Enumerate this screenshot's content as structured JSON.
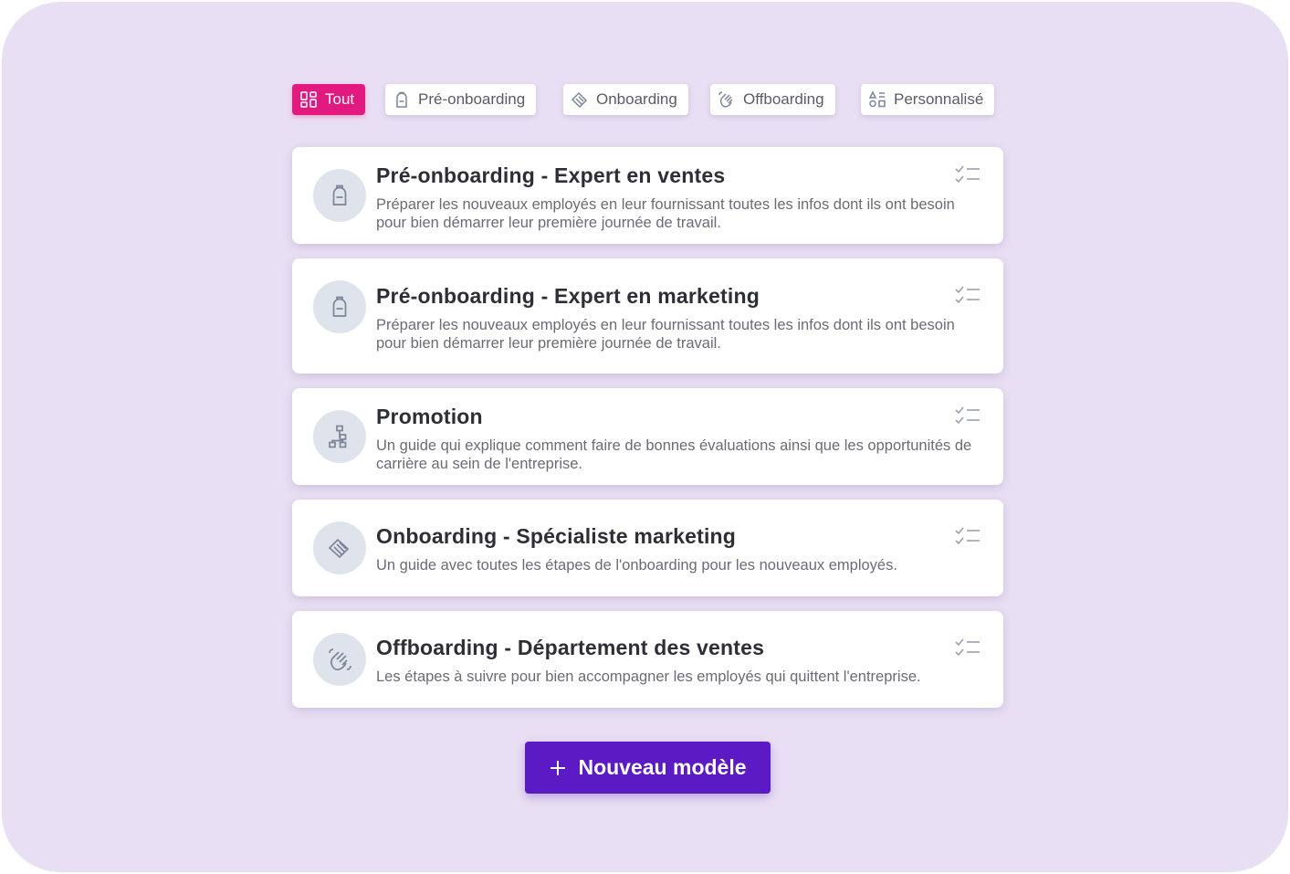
{
  "filters": [
    {
      "label": "Tout",
      "icon": "grid-icon",
      "active": true
    },
    {
      "label": "Pré-onboarding",
      "icon": "backpack-icon",
      "active": false
    },
    {
      "label": "Onboarding",
      "icon": "handshake-icon",
      "active": false
    },
    {
      "label": "Offboarding",
      "icon": "waving-hand-icon",
      "active": false
    },
    {
      "label": "Personnalisé",
      "icon": "shapes-icon",
      "active": false
    }
  ],
  "templates": [
    {
      "title": "Pré-onboarding - Expert en ventes",
      "description": "Préparer les nouveaux employés en leur fournissant toutes les infos dont ils ont besoin pour bien démarrer leur première journée de travail.",
      "icon": "backpack-icon"
    },
    {
      "title": "Pré-onboarding - Expert en marketing",
      "description": "Préparer les nouveaux employés en leur fournissant toutes les infos dont ils ont besoin pour bien démarrer leur première journée de travail.",
      "icon": "backpack-icon"
    },
    {
      "title": "Promotion",
      "description": "Un guide qui explique comment faire de bonnes évaluations ainsi que les opportunités de carrière au sein de l'entreprise.",
      "icon": "org-chart-icon"
    },
    {
      "title": "Onboarding - Spécialiste marketing",
      "description": "Un guide avec toutes les étapes de l'onboarding pour les nouveaux employés.",
      "icon": "handshake-icon"
    },
    {
      "title": "Offboarding - Département des ventes",
      "description": "Les étapes à suivre pour bien accompagner les employés qui quittent l'entreprise.",
      "icon": "waving-hand-icon"
    }
  ],
  "new_button": {
    "label": "Nouveau modèle",
    "icon": "plus-icon"
  },
  "colors": {
    "background": "#e9dff4",
    "active_chip": "#e2197f",
    "primary_button": "#5b1ac4",
    "icon_stroke": "#7d8499"
  }
}
